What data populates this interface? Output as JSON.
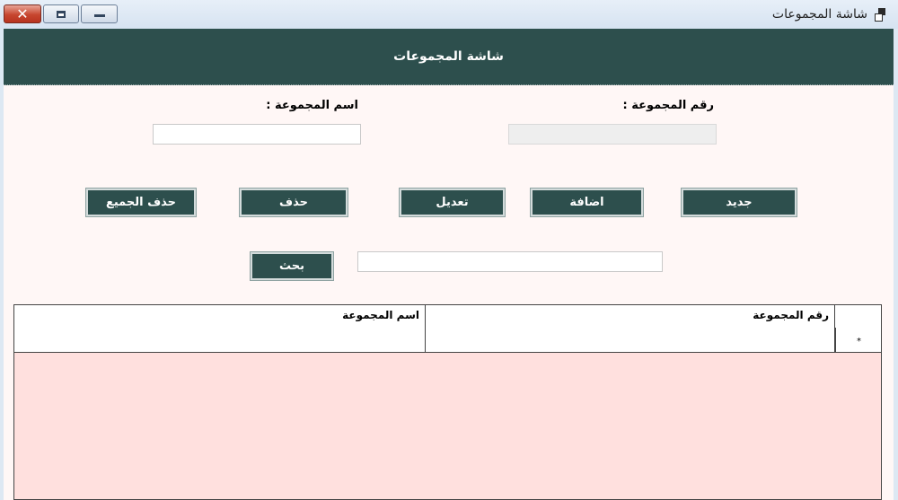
{
  "window": {
    "title": "شاشة المجموعات",
    "controls": {
      "close": "✕"
    }
  },
  "header": {
    "title": "شاشة المجموعات"
  },
  "form": {
    "group_number_label": "رقم المجموعة :",
    "group_number_value": "",
    "group_name_label": "اسم المجموعة :",
    "group_name_value": "",
    "search_value": ""
  },
  "buttons": {
    "new": "جديد",
    "add": "اضافة",
    "edit": "تعديل",
    "delete": "حذف",
    "delete_all": "حذف الجميع",
    "search": "بحث"
  },
  "grid": {
    "columns": [
      "رقم المجموعة",
      "اسم المجموعة"
    ],
    "rows": [
      {
        "group_number": "",
        "group_name": "",
        "marker": "*"
      }
    ]
  },
  "colors": {
    "header_bg": "#2d4f4d",
    "form_bg": "#fff7f6",
    "grid_bg": "#ffe0de",
    "close_button": "#c7462f"
  },
  "icons": [
    "app-icon",
    "close-icon",
    "restore-icon",
    "minimize-icon"
  ]
}
